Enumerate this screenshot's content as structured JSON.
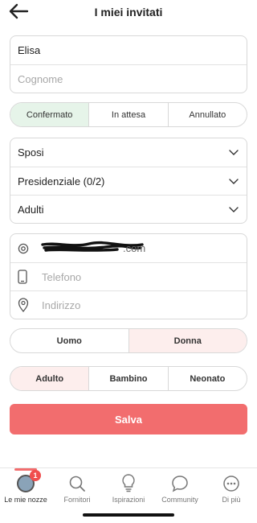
{
  "header": {
    "title": "I miei invitati",
    "back_icon": "arrow-left-icon"
  },
  "name_fields": {
    "first_name_value": "Elisa",
    "last_name_placeholder": "Cognome"
  },
  "status": {
    "options": [
      "Confermato",
      "In attesa",
      "Annullato"
    ],
    "selected": "Confermato",
    "selected_color": "#e6f4e9"
  },
  "selects": {
    "group": "Sposi",
    "table": "Presidenziale (0/2)",
    "age_group": "Adulti"
  },
  "contact": {
    "email_suffix": ".com",
    "email_redacted": true,
    "phone_placeholder": "Telefono",
    "address_placeholder": "Indirizzo"
  },
  "gender": {
    "options": [
      "Uomo",
      "Donna"
    ],
    "selected": "Donna"
  },
  "age": {
    "options": [
      "Adulto",
      "Bambino",
      "Neonato"
    ],
    "selected": "Adulto"
  },
  "save_label": "Salva",
  "accent_color": "#f26d6e",
  "tabbar": {
    "items": [
      {
        "label": "Le mie nozze",
        "icon": "avatar-icon",
        "badge": "1",
        "active": true
      },
      {
        "label": "Fornitori",
        "icon": "search-icon"
      },
      {
        "label": "Ispirazioni",
        "icon": "lightbulb-icon"
      },
      {
        "label": "Community",
        "icon": "chat-bubble-icon"
      },
      {
        "label": "Di più",
        "icon": "more-dots-icon"
      }
    ]
  }
}
